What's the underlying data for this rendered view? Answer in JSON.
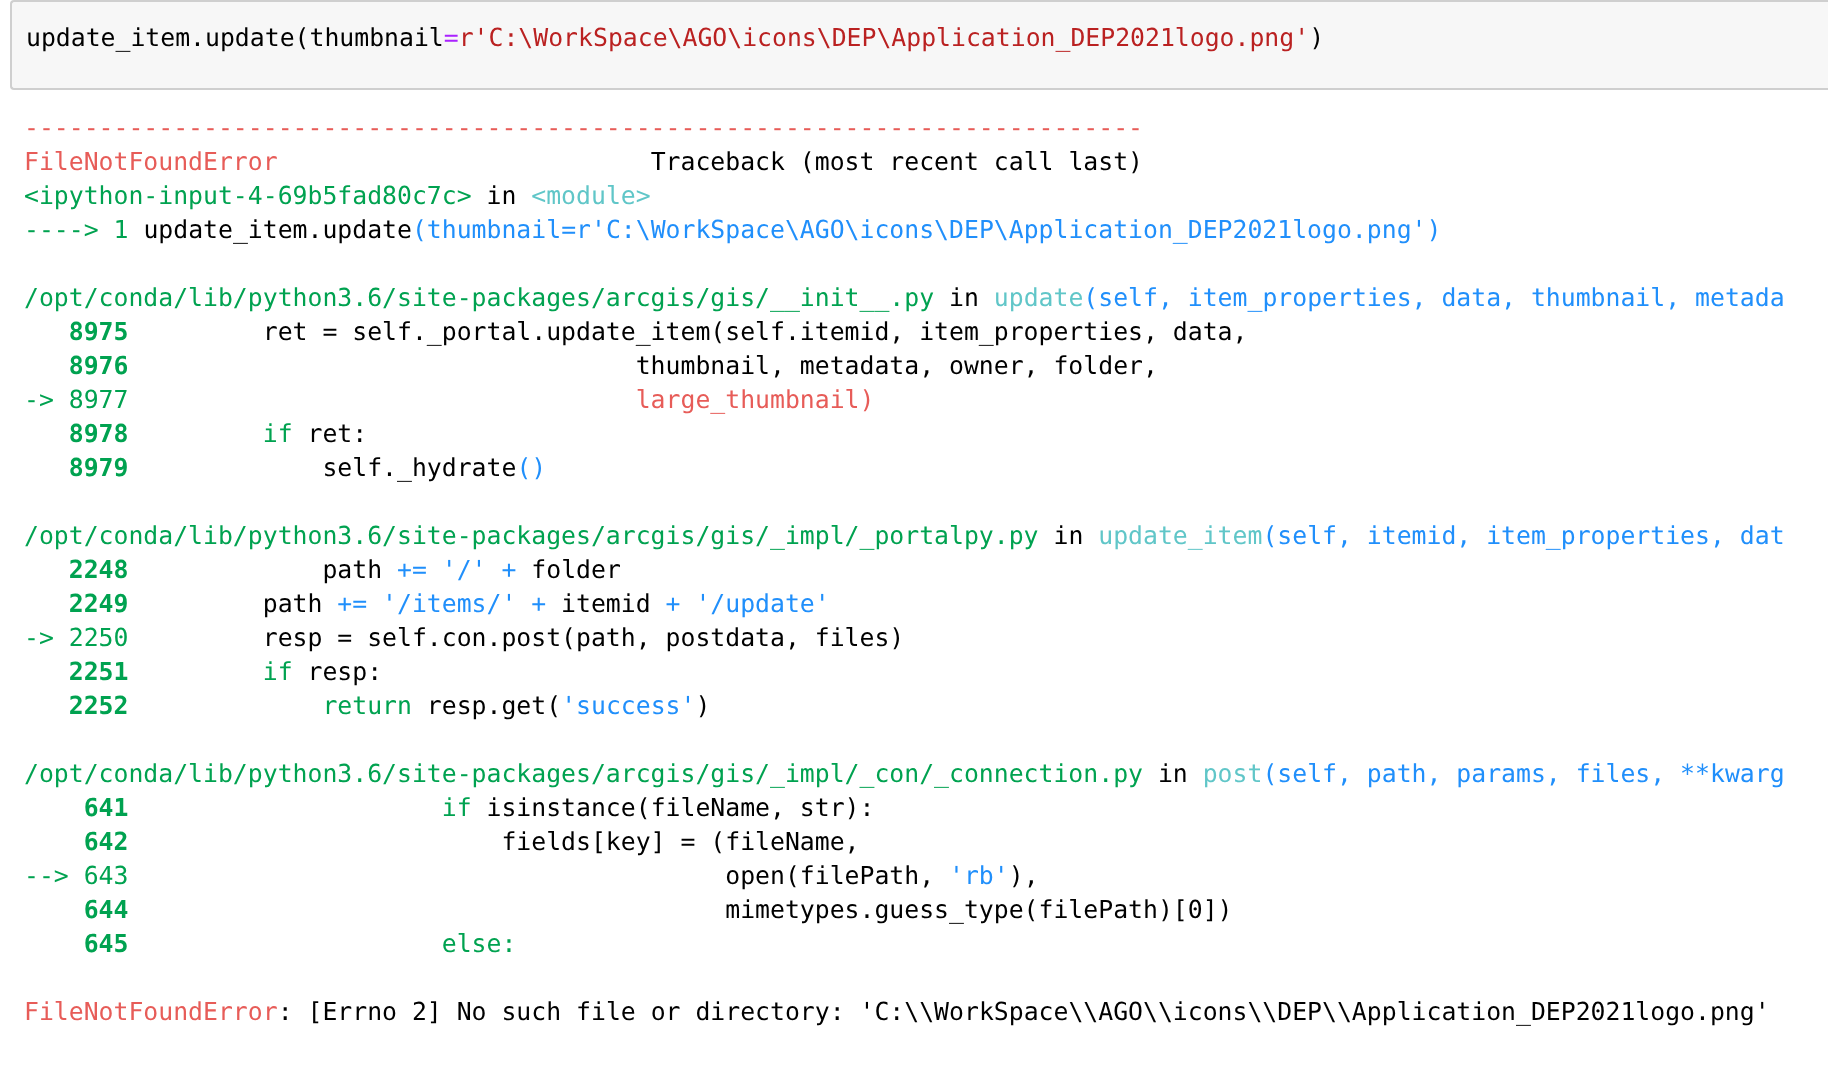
{
  "input_cell": {
    "code": [
      {
        "text": "update_item.update(thumbnail",
        "kind": "plain"
      },
      {
        "text": "=",
        "kind": "op"
      },
      {
        "text": "r'C:\\WorkSpace\\AGO\\icons\\DEP\\Application_DEP2021logo.png'",
        "kind": "str"
      },
      {
        "text": ")",
        "kind": "plain"
      }
    ]
  },
  "output": {
    "sections": [
      {
        "lines": [
          [
            {
              "text": "---------------------------------------------------------------------------",
              "kind": "error"
            }
          ],
          [
            {
              "text": "FileNotFoundError",
              "kind": "error"
            },
            {
              "text": "                         Traceback (most recent call last)",
              "kind": "plain"
            }
          ],
          [
            {
              "text": "<ipython-input-4-69b5fad80c7c>",
              "kind": "green"
            },
            {
              "text": " in ",
              "kind": "plain"
            },
            {
              "text": "<module>",
              "kind": "cyan"
            }
          ],
          [
            {
              "text": "----> 1 ",
              "kind": "green"
            },
            {
              "text": "update_item.update",
              "kind": "plain"
            },
            {
              "text": "(thumbnail=r'C:\\WorkSpace\\AGO\\icons\\DEP\\Application_DEP2021logo.png')",
              "kind": "blue"
            }
          ]
        ]
      },
      {
        "lines": [
          [
            {
              "text": "/opt/conda/lib/python3.6/site-packages/arcgis/gis/__init__.py",
              "kind": "green"
            },
            {
              "text": " in ",
              "kind": "plain"
            },
            {
              "text": "update",
              "kind": "cyan"
            },
            {
              "text": "(self, item_properties, data, thumbnail, metada",
              "kind": "blue"
            }
          ],
          [
            {
              "text": "   8975",
              "kind": "lineno"
            },
            {
              "text": "         ret = self._portal.update_item(self.itemid, item_properties, data,",
              "kind": "plain"
            }
          ],
          [
            {
              "text": "   8976",
              "kind": "lineno"
            },
            {
              "text": "                                  thumbnail, metadata, owner, folder,",
              "kind": "plain"
            }
          ],
          [
            {
              "text": "-> 8977",
              "kind": "green"
            },
            {
              "text": "                                  large_thumbnail)",
              "kind": "error"
            }
          ],
          [
            {
              "text": "   8978",
              "kind": "lineno"
            },
            {
              "text": "         if",
              "kind": "green"
            },
            {
              "text": " ret:",
              "kind": "plain"
            }
          ],
          [
            {
              "text": "   8979",
              "kind": "lineno"
            },
            {
              "text": "             self._hydrate",
              "kind": "plain"
            },
            {
              "text": "()",
              "kind": "blue"
            }
          ]
        ]
      },
      {
        "lines": [
          [
            {
              "text": "/opt/conda/lib/python3.6/site-packages/arcgis/gis/_impl/_portalpy.py",
              "kind": "green"
            },
            {
              "text": " in ",
              "kind": "plain"
            },
            {
              "text": "update_item",
              "kind": "cyan"
            },
            {
              "text": "(self, itemid, item_properties, dat",
              "kind": "blue"
            }
          ],
          [
            {
              "text": "   2248",
              "kind": "lineno"
            },
            {
              "text": "             path ",
              "kind": "plain"
            },
            {
              "text": "+= '/' +",
              "kind": "blue"
            },
            {
              "text": " folder",
              "kind": "plain"
            }
          ],
          [
            {
              "text": "   2249",
              "kind": "lineno"
            },
            {
              "text": "         path ",
              "kind": "plain"
            },
            {
              "text": "+= '/items/' +",
              "kind": "blue"
            },
            {
              "text": " itemid ",
              "kind": "plain"
            },
            {
              "text": "+ '/update'",
              "kind": "blue"
            }
          ],
          [
            {
              "text": "-> 2250",
              "kind": "green"
            },
            {
              "text": "         resp = self.con.post(path, postdata, files)",
              "kind": "plain"
            }
          ],
          [
            {
              "text": "   2251",
              "kind": "lineno"
            },
            {
              "text": "         if",
              "kind": "green"
            },
            {
              "text": " resp:",
              "kind": "plain"
            }
          ],
          [
            {
              "text": "   2252",
              "kind": "lineno"
            },
            {
              "text": "             return",
              "kind": "green"
            },
            {
              "text": " resp.get(",
              "kind": "plain"
            },
            {
              "text": "'success'",
              "kind": "blue"
            },
            {
              "text": ")",
              "kind": "plain"
            }
          ]
        ]
      },
      {
        "lines": [
          [
            {
              "text": "/opt/conda/lib/python3.6/site-packages/arcgis/gis/_impl/_con/_connection.py",
              "kind": "green"
            },
            {
              "text": " in ",
              "kind": "plain"
            },
            {
              "text": "post",
              "kind": "cyan"
            },
            {
              "text": "(self, path, params, files, **kwarg",
              "kind": "blue"
            }
          ],
          [
            {
              "text": "    641",
              "kind": "lineno"
            },
            {
              "text": "                     if",
              "kind": "green"
            },
            {
              "text": " isinstance(fileName, str):",
              "kind": "plain"
            }
          ],
          [
            {
              "text": "    642",
              "kind": "lineno"
            },
            {
              "text": "                         fields[key] = (fileName,",
              "kind": "plain"
            }
          ],
          [
            {
              "text": "--> 643",
              "kind": "green"
            },
            {
              "text": "                                        open(filePath, ",
              "kind": "plain"
            },
            {
              "text": "'rb'",
              "kind": "blue"
            },
            {
              "text": "),",
              "kind": "plain"
            }
          ],
          [
            {
              "text": "    644",
              "kind": "lineno"
            },
            {
              "text": "                                        mimetypes.guess_type(filePath)[0])",
              "kind": "plain"
            }
          ],
          [
            {
              "text": "    645",
              "kind": "lineno"
            },
            {
              "text": "                     else:",
              "kind": "green"
            }
          ]
        ]
      },
      {
        "lines": [
          [
            {
              "text": "FileNotFoundError",
              "kind": "error"
            },
            {
              "text": ": [Errno 2] No such file or directory: 'C:\\\\WorkSpace\\\\AGO\\\\icons\\\\DEP\\\\Application_DEP2021logo.png'",
              "kind": "plain"
            }
          ]
        ]
      }
    ]
  }
}
